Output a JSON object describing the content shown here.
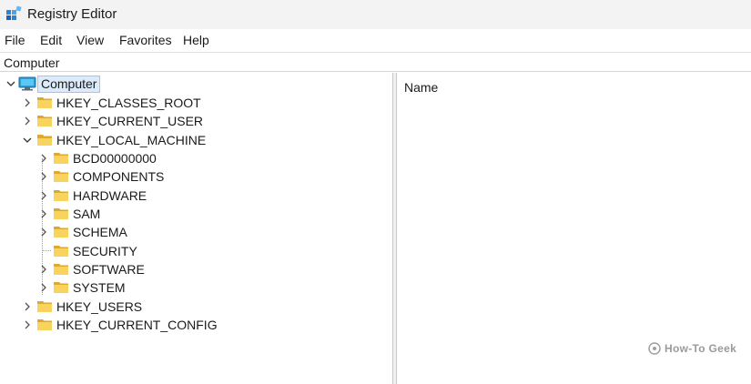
{
  "window": {
    "title": "Registry Editor"
  },
  "menu": [
    "File",
    "Edit",
    "View",
    "Favorites",
    "Help"
  ],
  "address": "Computer",
  "list": {
    "column_name": "Name"
  },
  "tree": {
    "root": "Computer",
    "hives": [
      "HKEY_CLASSES_ROOT",
      "HKEY_CURRENT_USER",
      "HKEY_LOCAL_MACHINE",
      "HKEY_USERS",
      "HKEY_CURRENT_CONFIG"
    ],
    "hklm_children": [
      "BCD00000000",
      "COMPONENTS",
      "HARDWARE",
      "SAM",
      "SCHEMA",
      "SECURITY",
      "SOFTWARE",
      "SYSTEM"
    ]
  },
  "watermark": "How-To Geek",
  "colors": {
    "folder": "#f4c542",
    "folder_dark": "#e0a92a",
    "selection": "#dcebfc",
    "selection_border": "#99c6f5"
  }
}
